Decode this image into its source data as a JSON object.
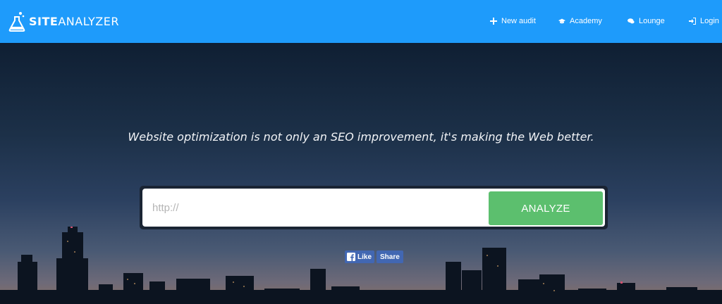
{
  "brand": {
    "name_bold": "SITE",
    "name_light": "ANALYZER"
  },
  "nav": {
    "new_audit": "New audit",
    "academy": "Academy",
    "lounge": "Lounge",
    "login": "Login"
  },
  "hero": {
    "tagline": "Website optimization is not only an SEO improvement, it's making the Web better."
  },
  "search": {
    "placeholder": "http://",
    "value": "",
    "button_label": "ANALYZE"
  },
  "social": {
    "like_label": "Like",
    "share_label": "Share"
  },
  "colors": {
    "navbar": "#1e9bfb",
    "analyze_button": "#5cbf6e",
    "facebook": "#4267b2"
  }
}
